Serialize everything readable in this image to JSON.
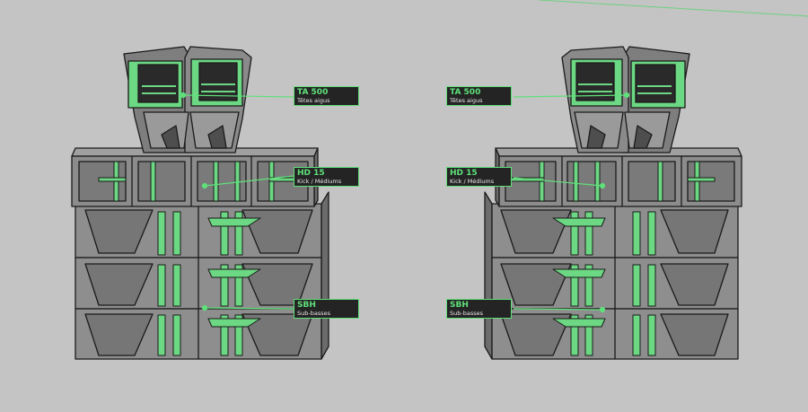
{
  "colors": {
    "background": "#c4c4c4",
    "speaker_gray": "#8c8c8c",
    "speaker_dark": "#5e5e5e",
    "accent_green": "#5fe07a",
    "label_bg": "#242424"
  },
  "stacks": [
    {
      "side": "left",
      "labels": [
        {
          "title": "TA 500",
          "subtitle": "Têtes aigus"
        },
        {
          "title": "HD 15",
          "subtitle": "Kick / Médiums"
        },
        {
          "title": "SBH",
          "subtitle": "Sub-basses"
        }
      ]
    },
    {
      "side": "right",
      "labels": [
        {
          "title": "TA 500",
          "subtitle": "Têtes aigus"
        },
        {
          "title": "HD 15",
          "subtitle": "Kick / Médiums"
        },
        {
          "title": "SBH",
          "subtitle": "Sub-basses"
        }
      ]
    }
  ]
}
